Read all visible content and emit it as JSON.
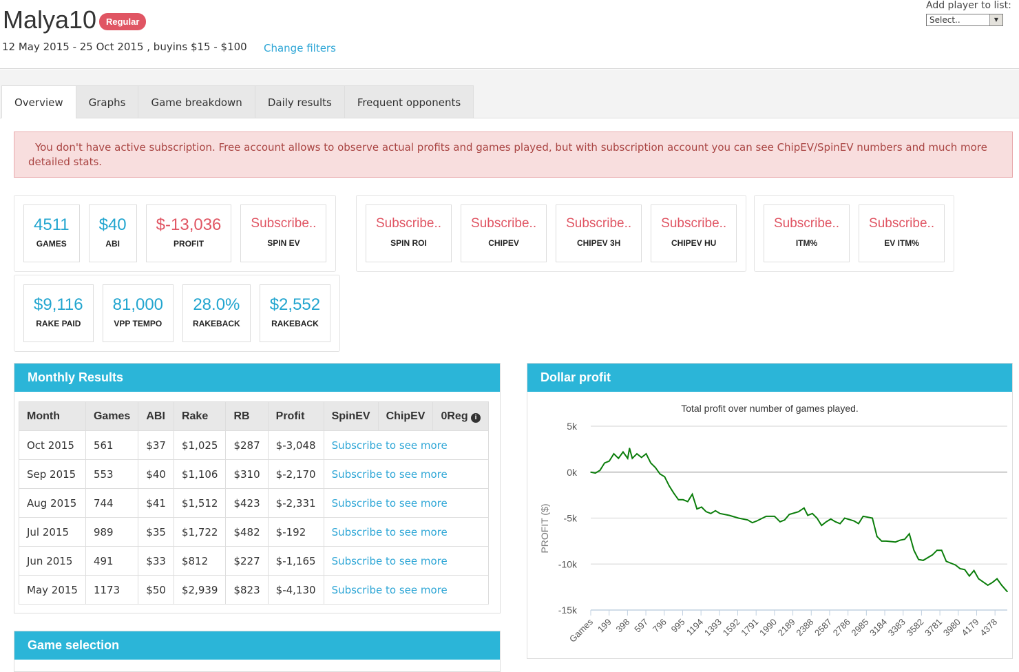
{
  "header": {
    "player": "Malya10",
    "badge": "Regular",
    "subtitle": "12 May 2015 - 25 Oct 2015 , buyins $15 - $100",
    "change_filters": "Change filters",
    "add_player_label": "Add player to list:",
    "select_value": "Select.."
  },
  "tabs": [
    "Overview",
    "Graphs",
    "Game breakdown",
    "Daily results",
    "Frequent opponents"
  ],
  "alert": "You don't have active subscription. Free account allows to observe actual profits and games played, but with subscription account you can see ChipEV/SpinEV numbers and much more detailed stats.",
  "stats_groups": [
    [
      {
        "value": "4511",
        "label": "GAMES"
      },
      {
        "value": "$40",
        "label": "ABI"
      },
      {
        "value": "$-13,036",
        "label": "PROFIT",
        "neg": true
      },
      {
        "value": "Subscribe..",
        "label": "SPIN EV",
        "sub": true
      }
    ],
    [
      {
        "value": "Subscribe..",
        "label": "SPIN ROI",
        "sub": true
      },
      {
        "value": "Subscribe..",
        "label": "CHIPEV",
        "sub": true
      },
      {
        "value": "Subscribe..",
        "label": "CHIPEV 3H",
        "sub": true
      },
      {
        "value": "Subscribe..",
        "label": "CHIPEV HU",
        "sub": true
      }
    ],
    [
      {
        "value": "Subscribe..",
        "label": "ITM%",
        "sub": true
      },
      {
        "value": "Subscribe..",
        "label": "EV ITM%",
        "sub": true
      }
    ],
    [
      {
        "value": "$9,116",
        "label": "RAKE PAID"
      },
      {
        "value": "81,000",
        "label": "VPP TEMPO"
      },
      {
        "value": "28.0%",
        "label": "RAKEBACK"
      },
      {
        "value": "$2,552",
        "label": "RAKEBACK"
      }
    ]
  ],
  "monthly": {
    "title": "Monthly Results",
    "columns": [
      "Month",
      "Games",
      "ABI",
      "Rake",
      "RB",
      "Profit",
      "SpinEV",
      "ChipEV",
      "0Reg"
    ],
    "info_icon": "info-circle-icon",
    "rows": [
      [
        "Oct 2015",
        "561",
        "$37",
        "$1,025",
        "$287",
        "$-3,048",
        "Subscribe to see more"
      ],
      [
        "Sep 2015",
        "553",
        "$40",
        "$1,106",
        "$310",
        "$-2,170",
        "Subscribe to see more"
      ],
      [
        "Aug 2015",
        "744",
        "$41",
        "$1,512",
        "$423",
        "$-2,331",
        "Subscribe to see more"
      ],
      [
        "Jul 2015",
        "989",
        "$35",
        "$1,722",
        "$482",
        "$-192",
        "Subscribe to see more"
      ],
      [
        "Jun 2015",
        "491",
        "$33",
        "$812",
        "$227",
        "$-1,165",
        "Subscribe to see more"
      ],
      [
        "May 2015",
        "1173",
        "$50",
        "$2,939",
        "$823",
        "$-4,130",
        "Subscribe to see more"
      ]
    ]
  },
  "game_selection": {
    "title": "Game selection"
  },
  "dollar_profit": {
    "title": "Dollar profit"
  },
  "chart_data": {
    "type": "line",
    "title": "Total profit over number of games played.",
    "ylabel": "PROFIT ($)",
    "ylim": [
      -15000,
      5000
    ],
    "yticks": [
      "5k",
      "0k",
      "-5k",
      "-10k",
      "-15k"
    ],
    "ytick_values": [
      5000,
      0,
      -5000,
      -10000,
      -15000
    ],
    "xtick_labels": [
      "Games",
      "199",
      "398",
      "597",
      "796",
      "995",
      "1194",
      "1393",
      "1592",
      "1791",
      "1990",
      "2189",
      "2388",
      "2587",
      "2786",
      "2985",
      "3184",
      "3383",
      "3582",
      "3781",
      "3980",
      "4179",
      "4378"
    ],
    "xlim": [
      0,
      4511
    ],
    "grid": true,
    "color": "#0a7d0a",
    "series": [
      {
        "x": [
          0,
          50,
          100,
          150,
          200,
          250,
          300,
          350,
          400,
          420,
          450,
          500,
          550,
          600,
          650,
          700,
          750,
          800,
          850,
          900,
          950,
          1000,
          1050,
          1100,
          1150,
          1200,
          1250,
          1300,
          1350,
          1400,
          1500,
          1600,
          1700,
          1750,
          1800,
          1900,
          1990,
          2050,
          2100,
          2150,
          2250,
          2310,
          2350,
          2400,
          2450,
          2500,
          2550,
          2600,
          2650,
          2700,
          2750,
          2850,
          2900,
          2950,
          3050,
          3100,
          3150,
          3200,
          3300,
          3350,
          3400,
          3450,
          3500,
          3550,
          3600,
          3700,
          3750,
          3800,
          3850,
          3950,
          4000,
          4050,
          4100,
          4150,
          4200,
          4300,
          4350,
          4400,
          4450,
          4511
        ],
        "y": [
          0,
          -100,
          200,
          1000,
          1200,
          2000,
          1500,
          2200,
          1500,
          2600,
          1500,
          2000,
          1600,
          2000,
          1000,
          500,
          -200,
          -500,
          -1500,
          -2300,
          -3000,
          -3000,
          -3200,
          -2400,
          -4000,
          -3800,
          -4300,
          -4500,
          -4200,
          -4500,
          -4700,
          -5000,
          -5200,
          -5500,
          -5300,
          -4800,
          -4800,
          -5400,
          -5200,
          -4600,
          -4300,
          -3900,
          -4700,
          -4500,
          -5000,
          -5800,
          -5400,
          -5100,
          -5400,
          -5600,
          -5000,
          -5300,
          -5600,
          -4800,
          -5000,
          -7000,
          -7500,
          -7500,
          -7600,
          -7400,
          -7300,
          -6700,
          -8500,
          -9500,
          -9600,
          -9000,
          -8500,
          -8500,
          -9700,
          -10100,
          -10500,
          -10600,
          -11300,
          -10700,
          -11600,
          -12300,
          -12000,
          -11600,
          -12300,
          -13000
        ]
      }
    ]
  }
}
